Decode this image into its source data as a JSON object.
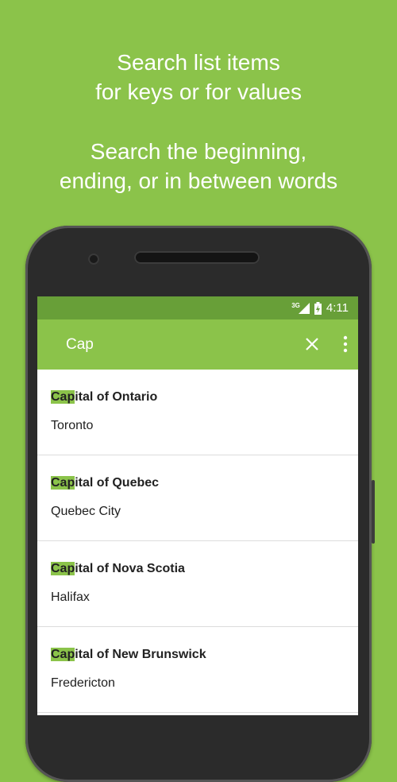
{
  "promo": {
    "line1": "Search list items",
    "line2": "for keys or for values",
    "line3": "Search the beginning,",
    "line4": "ending, or in between words"
  },
  "statusbar": {
    "network": "3G",
    "time": "4:11"
  },
  "search": {
    "query": "Cap",
    "clear_icon": "close-icon",
    "menu_icon": "more-vert-icon"
  },
  "colors": {
    "background": "#8bc34a",
    "statusbar": "#689f38",
    "highlight": "#8bc34a"
  },
  "results": [
    {
      "match": "Cap",
      "rest": "ital of Ontario",
      "value": "Toronto"
    },
    {
      "match": "Cap",
      "rest": "ital of Quebec",
      "value": "Quebec City"
    },
    {
      "match": "Cap",
      "rest": "ital of Nova Scotia",
      "value": "Halifax"
    },
    {
      "match": "Cap",
      "rest": "ital of New Brunswick",
      "value": "Fredericton"
    }
  ]
}
